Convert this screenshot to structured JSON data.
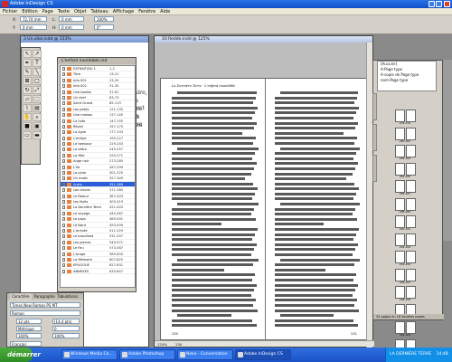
{
  "window": {
    "title": "Adobe InDesign CS"
  },
  "menu": [
    "Fichier",
    "Edition",
    "Page",
    "Texte",
    "Objet",
    "Tableau",
    "Affichage",
    "Fenêtre",
    "Aide"
  ],
  "control": {
    "x": "72,74 mm",
    "y": "0 mm",
    "w": "0 mm",
    "h": "0 mm",
    "zoom": "100%",
    "angle": "0°"
  },
  "doc1": {
    "tab": "3 Un.aliol.indd @ 153%",
    "text_fragments": [
      "raire, s",
      "on peut",
      "ces. En",
      "les pou",
      "ires p"
    ]
  },
  "pages_panel": {
    "title": "L'enfant inondable.ind",
    "items": [
      {
        "name": "EXTRAIT/DU 1",
        "range": "1-2"
      },
      {
        "name": "Titre",
        "range": "13-21"
      },
      {
        "name": "Info 001",
        "range": "23-29"
      },
      {
        "name": "Info 002",
        "range": "31-35"
      },
      {
        "name": "Une tombe",
        "range": "37-61"
      },
      {
        "name": "Un chef",
        "range": "63-73"
      },
      {
        "name": "Saint Grand",
        "range": "85-119"
      },
      {
        "name": "Les petits",
        "range": "121-135"
      },
      {
        "name": "Une maison",
        "range": "137-145"
      },
      {
        "name": "La fuite",
        "range": "147-155"
      },
      {
        "name": "Réveil",
        "range": "157-175"
      },
      {
        "name": "La ligne",
        "range": "177-193"
      },
      {
        "name": "L'enfant",
        "range": "195-227"
      },
      {
        "name": "Le tambour",
        "range": "229-243"
      },
      {
        "name": "La lettre",
        "range": "245-257"
      },
      {
        "name": "La fête",
        "range": "259-271"
      },
      {
        "name": "Ange noir",
        "range": "273-285"
      },
      {
        "name": "L'île",
        "range": "287-299"
      },
      {
        "name": "La pluie",
        "range": "301-325"
      },
      {
        "name": "Un matin",
        "range": "327-349"
      },
      {
        "name": "Autre",
        "range": "351-369"
      },
      {
        "name": "Les chiens",
        "range": "371-385"
      },
      {
        "name": "Le Retour",
        "range": "387-403"
      },
      {
        "name": "Les Nuits",
        "range": "405-419"
      },
      {
        "name": "La Dernière Terre",
        "range": "421-443"
      },
      {
        "name": "Le voyage",
        "range": "445-467"
      },
      {
        "name": "Le pays",
        "range": "469-491"
      },
      {
        "name": "Le Nord",
        "range": "493-509"
      },
      {
        "name": "L'arrivée",
        "range": "511-529"
      },
      {
        "name": "Le brouillard",
        "range": "531-547"
      },
      {
        "name": "Les pierres",
        "range": "549-571"
      },
      {
        "name": "Le Feu",
        "range": "573-587"
      },
      {
        "name": "L'orage",
        "range": "589-605"
      },
      {
        "name": "La Mémoire",
        "range": "607-625"
      },
      {
        "name": "EPILOGUE",
        "range": "627-631"
      },
      {
        "name": "ANNEXES",
        "range": "633-647"
      }
    ],
    "selected_index": 20
  },
  "char_panel": {
    "tabs": [
      "Caractère",
      "Paragraphe",
      "Tabulations"
    ],
    "font": "Times New Roman PS MT",
    "style": "Roman",
    "size": "12 pts",
    "leading": "(14,4 pts)",
    "tracking": "Métrique",
    "kerning": "0",
    "vscale": "100%",
    "hscale": "100%",
    "baseline": "0 pt",
    "skew": "0°",
    "language": "Français"
  },
  "doc2": {
    "tab": "10 Redde.indd @ 125%",
    "running_head": "La Dernière Terre · L'enfant inondable",
    "folio_left": "230",
    "folio_right": "231",
    "right_line_count": 52,
    "left_line_count": 52,
    "zoom": "125%",
    "page_field": "230"
  },
  "master_panel": {
    "items": [
      "[Aucune]",
      "A-Page type",
      "A-copie de Page type",
      "nom-Page type"
    ],
    "footer": "34 pages en 18 doubles pages"
  },
  "spreads": [
    {
      "label": "278-279"
    },
    {
      "label": "280-281"
    },
    {
      "label": "282-283"
    },
    {
      "label": "284-285"
    },
    {
      "label": "286-287"
    },
    {
      "label": "288-289"
    },
    {
      "label": "290-291"
    },
    {
      "label": "292-293"
    },
    {
      "label": "294-295"
    },
    {
      "label": "296-297"
    },
    {
      "label": "298-299"
    },
    {
      "label": "300-301"
    },
    {
      "label": "302-303"
    },
    {
      "label": "304-305"
    },
    {
      "label": "306-307"
    }
  ],
  "taskbar": {
    "start": "démarrer",
    "buttons": [
      "Windows Media Ce...",
      "Adobe Photoshop",
      "Neko - Conversation",
      "Adobe InDesign CS"
    ],
    "active_index": 3,
    "tray_text": "LA DERNIÈRE TERRE",
    "clock": "14:48"
  }
}
